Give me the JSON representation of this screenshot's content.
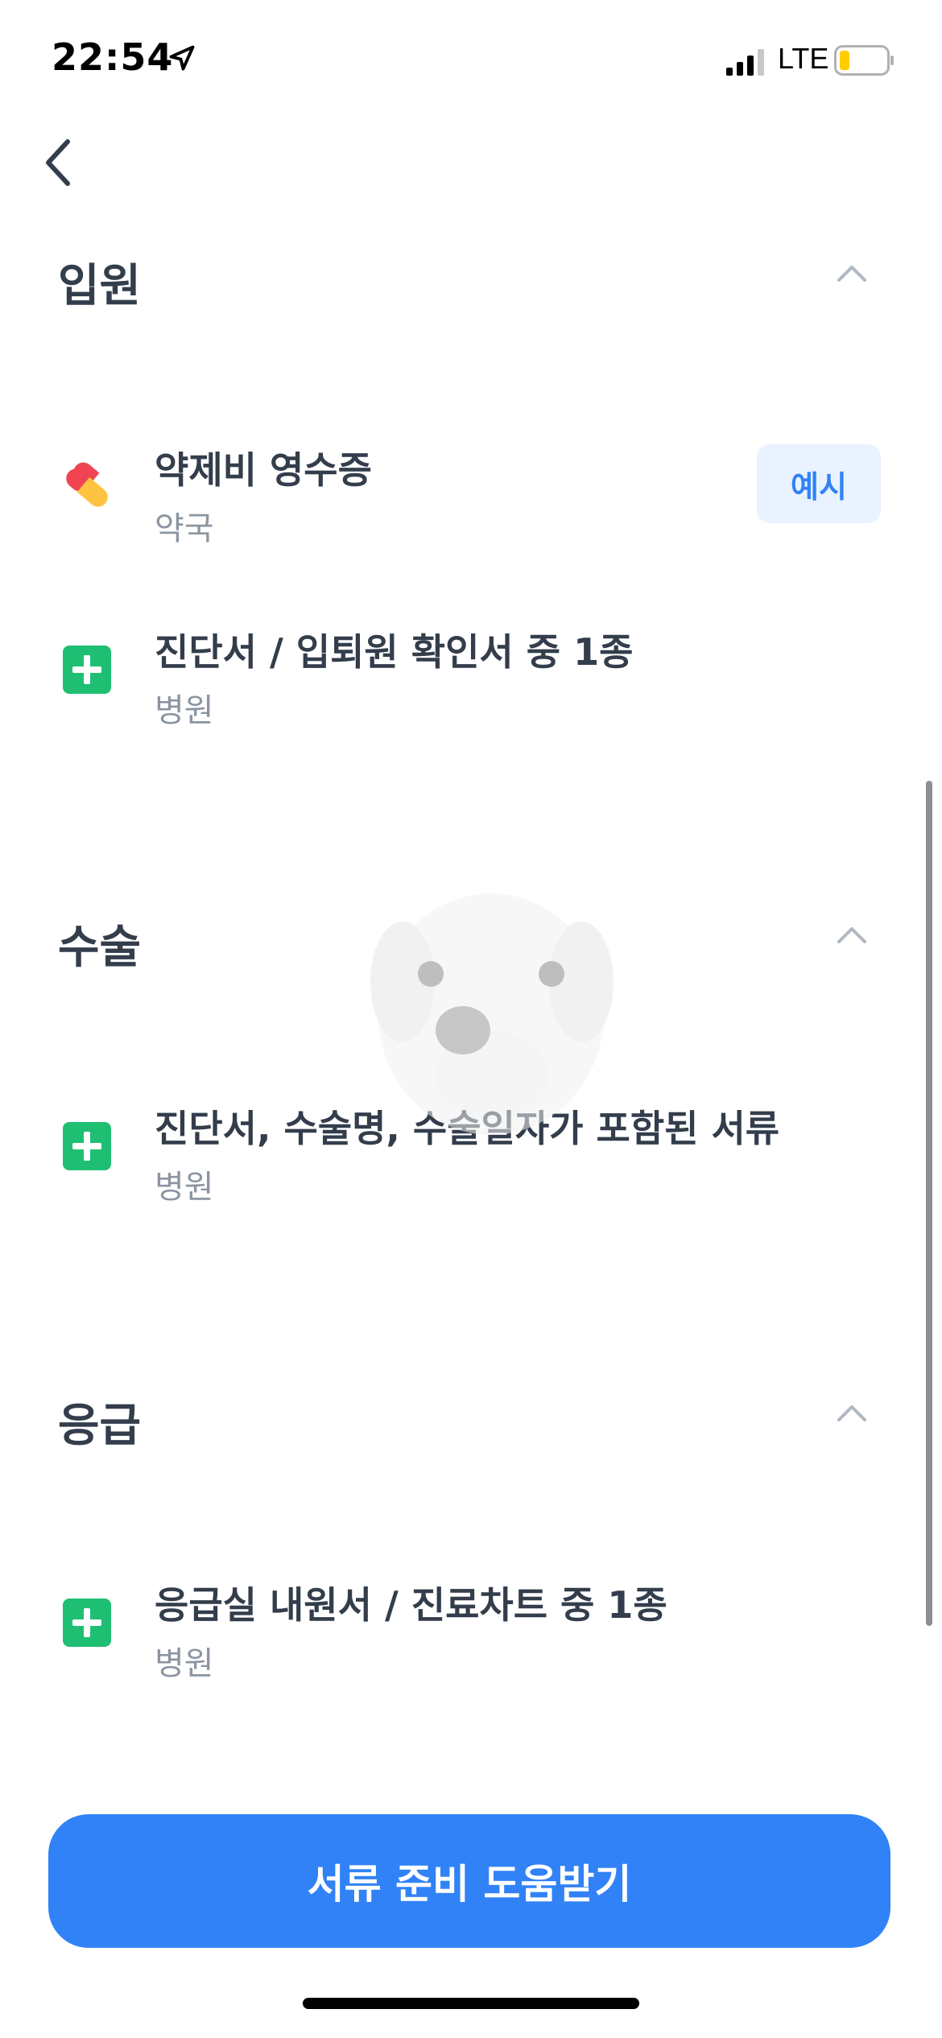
{
  "status_bar": {
    "time": "22:54",
    "network": "LTE",
    "icons": [
      "location-arrow-icon",
      "cellular-signal-icon",
      "battery-low-icon"
    ]
  },
  "nav": {
    "back_icon": "chevron-left-icon"
  },
  "sections": [
    {
      "title": "입원",
      "items": [
        {
          "title": "약제비 영수증",
          "source": "약국",
          "icon": "pill-icon",
          "example_label": "예시"
        },
        {
          "title": "진단서 / 입퇴원 확인서 중 1종",
          "source": "병원",
          "icon": "medical-cross-icon"
        }
      ]
    },
    {
      "title": "수술",
      "items": [
        {
          "title": "진단서, 수술명, 수술일자가 포함된 서류",
          "source": "병원",
          "icon": "medical-cross-icon"
        }
      ]
    },
    {
      "title": "응급",
      "items": [
        {
          "title": "응급실 내원서 / 진료차트 중 1종",
          "source": "병원",
          "icon": "medical-cross-icon"
        }
      ]
    }
  ],
  "cta": {
    "label": "서류 준비 도움받기"
  },
  "colors": {
    "accent": "#3182f6",
    "accent_light": "#e8f3ff",
    "green": "#1fbf73",
    "pill_red": "#f04452",
    "pill_yellow": "#ffc342",
    "text_primary": "#333d4b",
    "text_secondary": "#8b95a1"
  }
}
